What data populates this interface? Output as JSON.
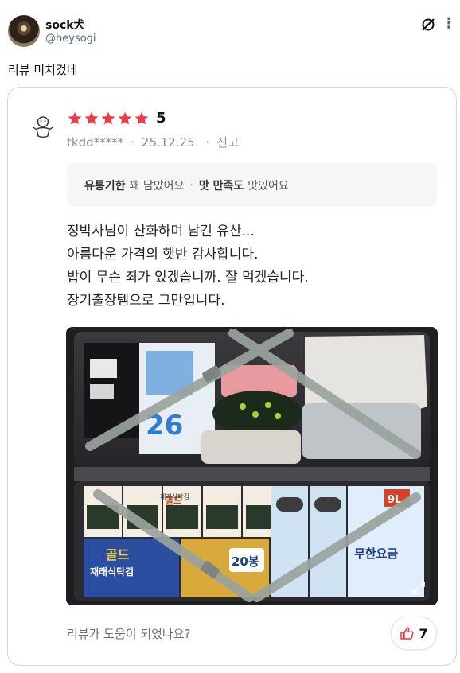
{
  "tweet": {
    "author_name": "sock犬",
    "author_handle": "@heysogi",
    "text": "리뷰 미치겄네"
  },
  "review_card": {
    "rating": "5",
    "star_count": 5,
    "star_color": "#f03a47",
    "reviewer_id": "tkdd*****",
    "date": "25.12.25.",
    "report_label": "신고",
    "separator": "·",
    "attributes": [
      {
        "key": "유통기한",
        "value": "꽤 남았어요"
      },
      {
        "key": "맛 만족도",
        "value": "맛있어요"
      }
    ],
    "body_lines": [
      "정박사님이 산화하며 남긴 유산...",
      "아름다운 가격의 햇반 감사합니다.",
      "밥이 무슨 죄가 있겠습니까. 잘 먹겠습니다.",
      "장기출장템으로 그만입니다."
    ],
    "photo_labels": {
      "laver_brand": "골드",
      "laver_name": "재래식탁김",
      "laver_pack": "20봉",
      "right_pack_count": "9L",
      "right_pack_name": "무한요금",
      "box_number": "26"
    },
    "helpful_question": "리뷰가 도움이 되었나요?",
    "like_count": "7"
  }
}
